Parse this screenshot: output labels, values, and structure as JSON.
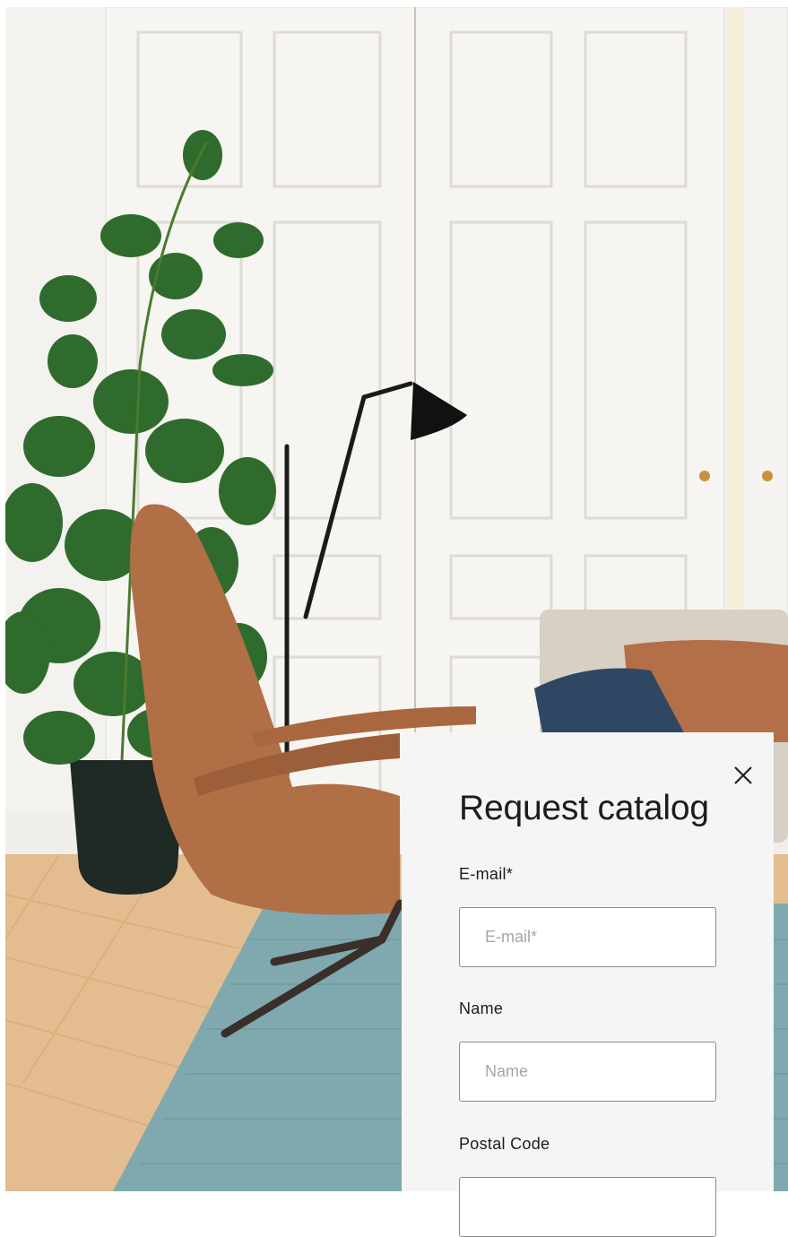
{
  "modal": {
    "title": "Request catalog",
    "close_icon": "close-icon",
    "fields": [
      {
        "label": "E-mail*",
        "placeholder": "E-mail*",
        "value": ""
      },
      {
        "label": "Name",
        "placeholder": "Name",
        "value": ""
      },
      {
        "label": "Postal Code",
        "placeholder": "",
        "value": ""
      }
    ]
  },
  "colors": {
    "panel_bg": "#f5f5f5",
    "text": "#1c1c1c",
    "placeholder": "#a6a6a6",
    "field_border": "#8a8a8a"
  }
}
